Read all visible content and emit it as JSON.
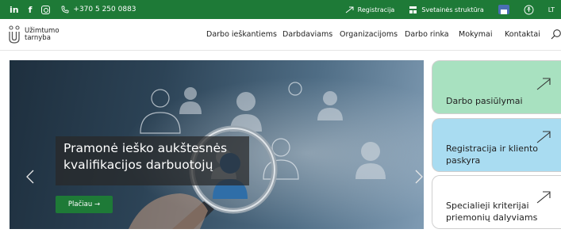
{
  "topbar": {
    "social": [
      {
        "icon": "linkedin-icon",
        "label": "in"
      },
      {
        "icon": "facebook-icon",
        "label": "f"
      },
      {
        "icon": "instagram-icon",
        "label": ""
      }
    ],
    "phone": "+370 5 250 0883",
    "registration": "Registracija",
    "sitemap": "Svetainės struktūra",
    "language": "LT"
  },
  "header": {
    "logo": {
      "line1": "Užimtumo",
      "line2": "tarnyba"
    },
    "nav": [
      "Darbo ieškantiems",
      "Darbdaviams",
      "Organizacijoms",
      "Darbo rinka",
      "Mokymai",
      "Kontaktai"
    ]
  },
  "hero": {
    "title": "Pramonė ieško aukštesnės kvalifikacijos darbuotojų",
    "button": "Plačiau →"
  },
  "cards": [
    {
      "label": "Darbo pasiūlymai",
      "color": "#a8e1c0"
    },
    {
      "label": "Registracija ir kliento paskyra",
      "color": "#a9dcf1"
    },
    {
      "label": "Specialieji kriterijai priemonių dalyviams",
      "color": "#ffffff"
    }
  ],
  "colors": {
    "brand_green": "#1e7a37"
  }
}
